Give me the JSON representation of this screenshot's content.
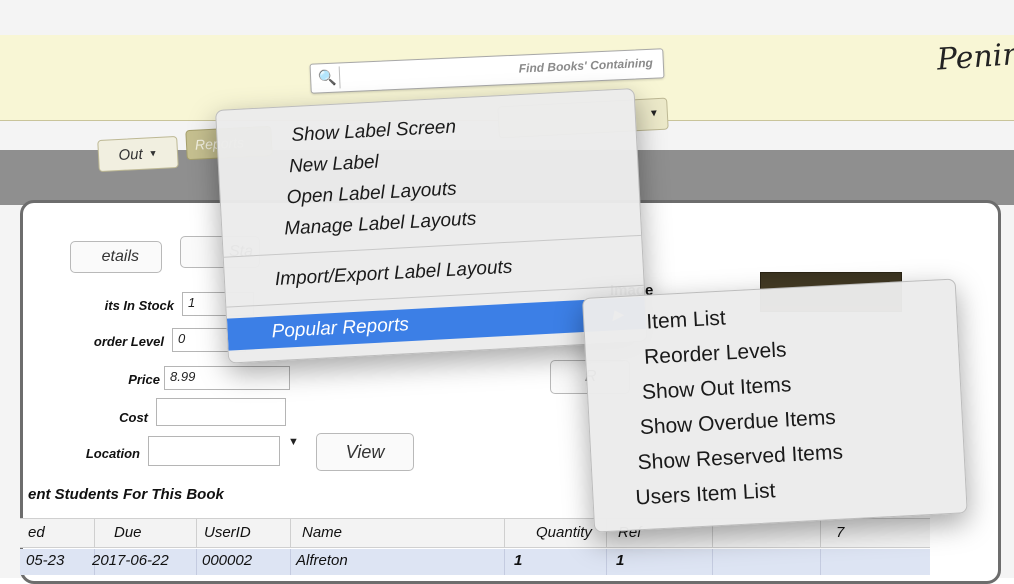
{
  "brand": {
    "logo_text": "Peninsula"
  },
  "search": {
    "placeholder": "Find Books' Containing"
  },
  "tabs": {
    "out_label": "Out",
    "reports_label": "Reports"
  },
  "form": {
    "details_button": "etails",
    "status_button": "Sta",
    "view_button": "View",
    "r_button": "R",
    "units_in_stock_label": "its In Stock",
    "units_in_stock_value": "1",
    "reorder_level_label": "order Level",
    "reorder_level_value": "0",
    "price_label": "Price",
    "price_value": "8.99",
    "cost_label": "Cost",
    "cost_value": "",
    "location_label": "Location",
    "location_value": "",
    "image_label": "Image"
  },
  "students_section": {
    "title": "ent Students For This Book",
    "columns": [
      "ed",
      "Due",
      "UserID",
      "Name",
      "Quantity",
      "Ref",
      "",
      "7"
    ],
    "rows": [
      {
        "issued": "05-23",
        "due": "2017-06-22",
        "userid": "000002",
        "name": "Alfreton",
        "quantity": "1",
        "ref": "1"
      }
    ]
  },
  "reports_menu": {
    "items": [
      {
        "label": "Show Label Screen"
      },
      {
        "label": "New Label"
      },
      {
        "label": "Open Label Layouts"
      },
      {
        "label": "Manage Label Layouts"
      },
      {
        "label": "Import/Export Label Layouts"
      },
      {
        "label": "Popular Reports",
        "arrow": "▶"
      }
    ]
  },
  "popular_reports_submenu": {
    "items": [
      {
        "label": "Item List"
      },
      {
        "label": "Reorder Levels"
      },
      {
        "label": "Show Out Items"
      },
      {
        "label": "Show Overdue Items"
      },
      {
        "label": "Show Reserved Items"
      },
      {
        "label": "Users Item List"
      }
    ]
  },
  "colors": {
    "toolbar_bg": "#f8f6d5",
    "menu_highlight": "#3c7fe6",
    "selected_row": "#dde4f3"
  }
}
